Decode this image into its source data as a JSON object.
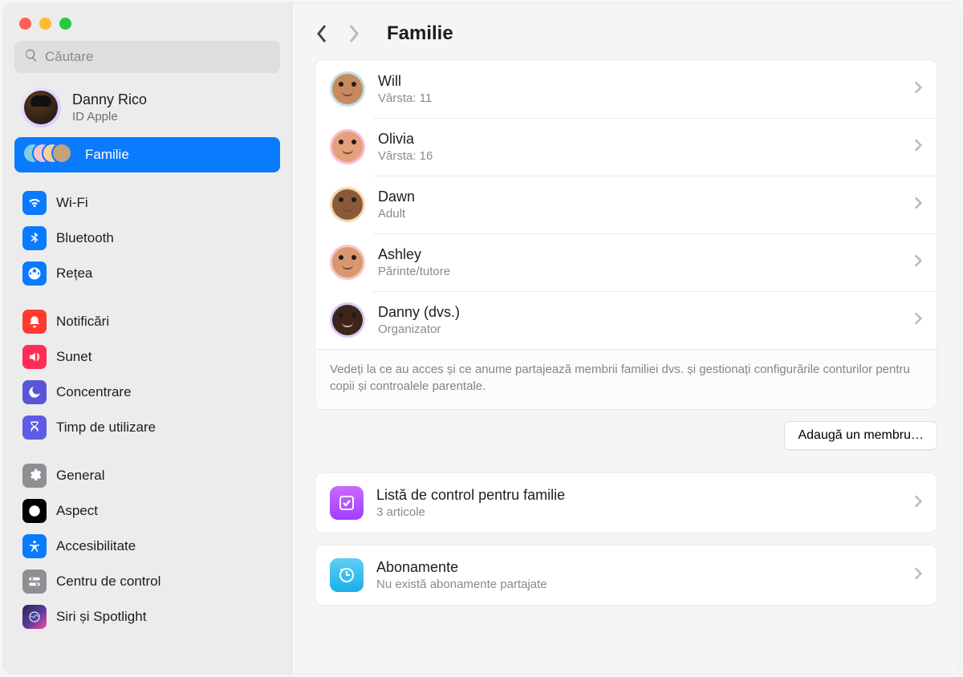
{
  "search": {
    "placeholder": "Căutare"
  },
  "account": {
    "name": "Danny Rico",
    "sub": "ID Apple"
  },
  "sidebar": {
    "family_label": "Familie",
    "items_net": [
      {
        "label": "Wi-Fi"
      },
      {
        "label": "Bluetooth"
      },
      {
        "label": "Rețea"
      }
    ],
    "items_focus": [
      {
        "label": "Notificări"
      },
      {
        "label": "Sunet"
      },
      {
        "label": "Concentrare"
      },
      {
        "label": "Timp de utilizare"
      }
    ],
    "items_general": [
      {
        "label": "General"
      },
      {
        "label": "Aspect"
      },
      {
        "label": "Accesibilitate"
      },
      {
        "label": "Centru de control"
      },
      {
        "label": "Siri și Spotlight"
      }
    ]
  },
  "header": {
    "title": "Familie"
  },
  "members": [
    {
      "name": "Will",
      "sub": "Vârsta: 11",
      "avatar_bg": "#bfe0e8"
    },
    {
      "name": "Olivia",
      "sub": "Vârsta: 16",
      "avatar_bg": "#fabdd2"
    },
    {
      "name": "Dawn",
      "sub": "Adult",
      "avatar_bg": "#f4d8b0"
    },
    {
      "name": "Ashley",
      "sub": "Părinte/tutore",
      "avatar_bg": "#f8c5c5"
    },
    {
      "name": "Danny (dvs.)",
      "sub": "Organizator",
      "avatar_bg": "#d8caff"
    }
  ],
  "members_footer": "Vedeți la ce au acces și ce anume partajează membrii familiei dvs. și gestionați configurările conturilor pentru copii și controalele parentale.",
  "add_member_label": "Adaugă un membru…",
  "options": {
    "checklist": {
      "title": "Listă de control pentru familie",
      "sub": "3 articole"
    },
    "subscriptions": {
      "title": "Abonamente",
      "sub": "Nu există abonamente partajate"
    }
  }
}
